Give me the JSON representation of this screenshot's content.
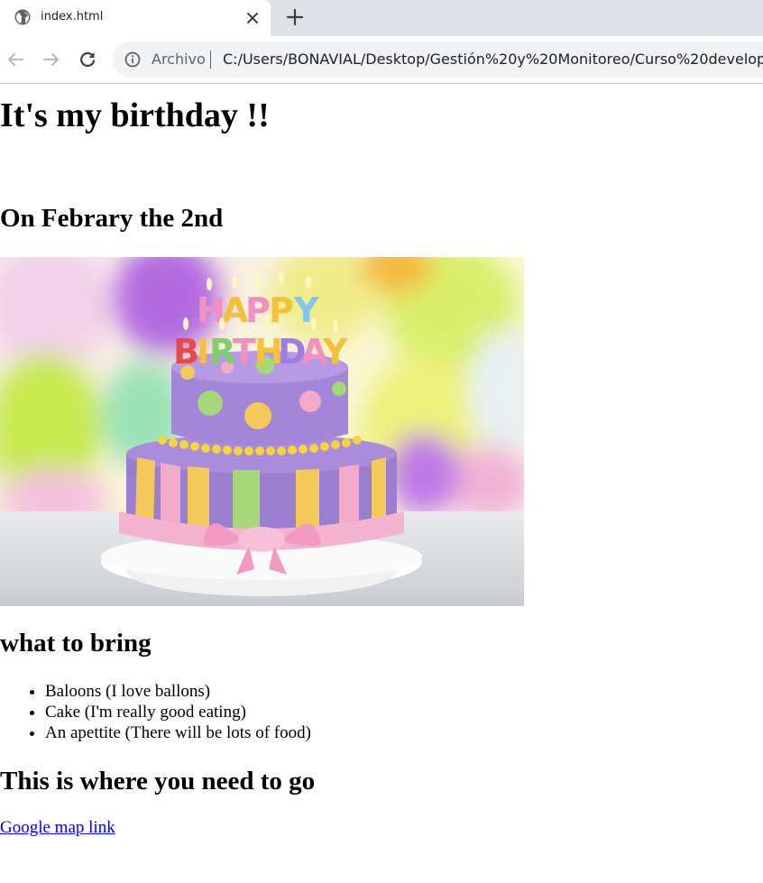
{
  "browser": {
    "tab": {
      "title": "index.html",
      "favicon_icon": "globe-icon",
      "close_icon": "close-icon"
    },
    "new_tab_icon": "plus-icon",
    "nav": {
      "back_icon": "arrow-left-icon",
      "forward_icon": "arrow-right-icon",
      "reload_icon": "reload-icon"
    },
    "omnibox": {
      "info_icon": "info-icon",
      "security_label": "Archivo",
      "url": "C:/Users/BONAVIAL/Desktop/Gestión%20y%20Monitoreo/Curso%20develop/"
    }
  },
  "page": {
    "title": "It's my birthday !!",
    "date_heading": "On Febrary the 2nd",
    "image": {
      "subject": "birthday-cake-photo",
      "cake_topper_text": "HAPPY BIRTHDAY"
    },
    "bring_heading": "what to bring",
    "bring_items": [
      "Baloons (I love ballons)",
      "Cake (I'm really good eating)",
      "An apettite (There will be lots of food)"
    ],
    "where_heading": "This is where you need to go",
    "map_link_text": "Google map link"
  },
  "colors": {
    "tabstrip_bg": "#dee1e6",
    "omnibox_bg": "#f1f3f4",
    "link": "#0000ee",
    "cake_purple": "#9a7fd1",
    "cake_pink": "#f3a9c8"
  }
}
